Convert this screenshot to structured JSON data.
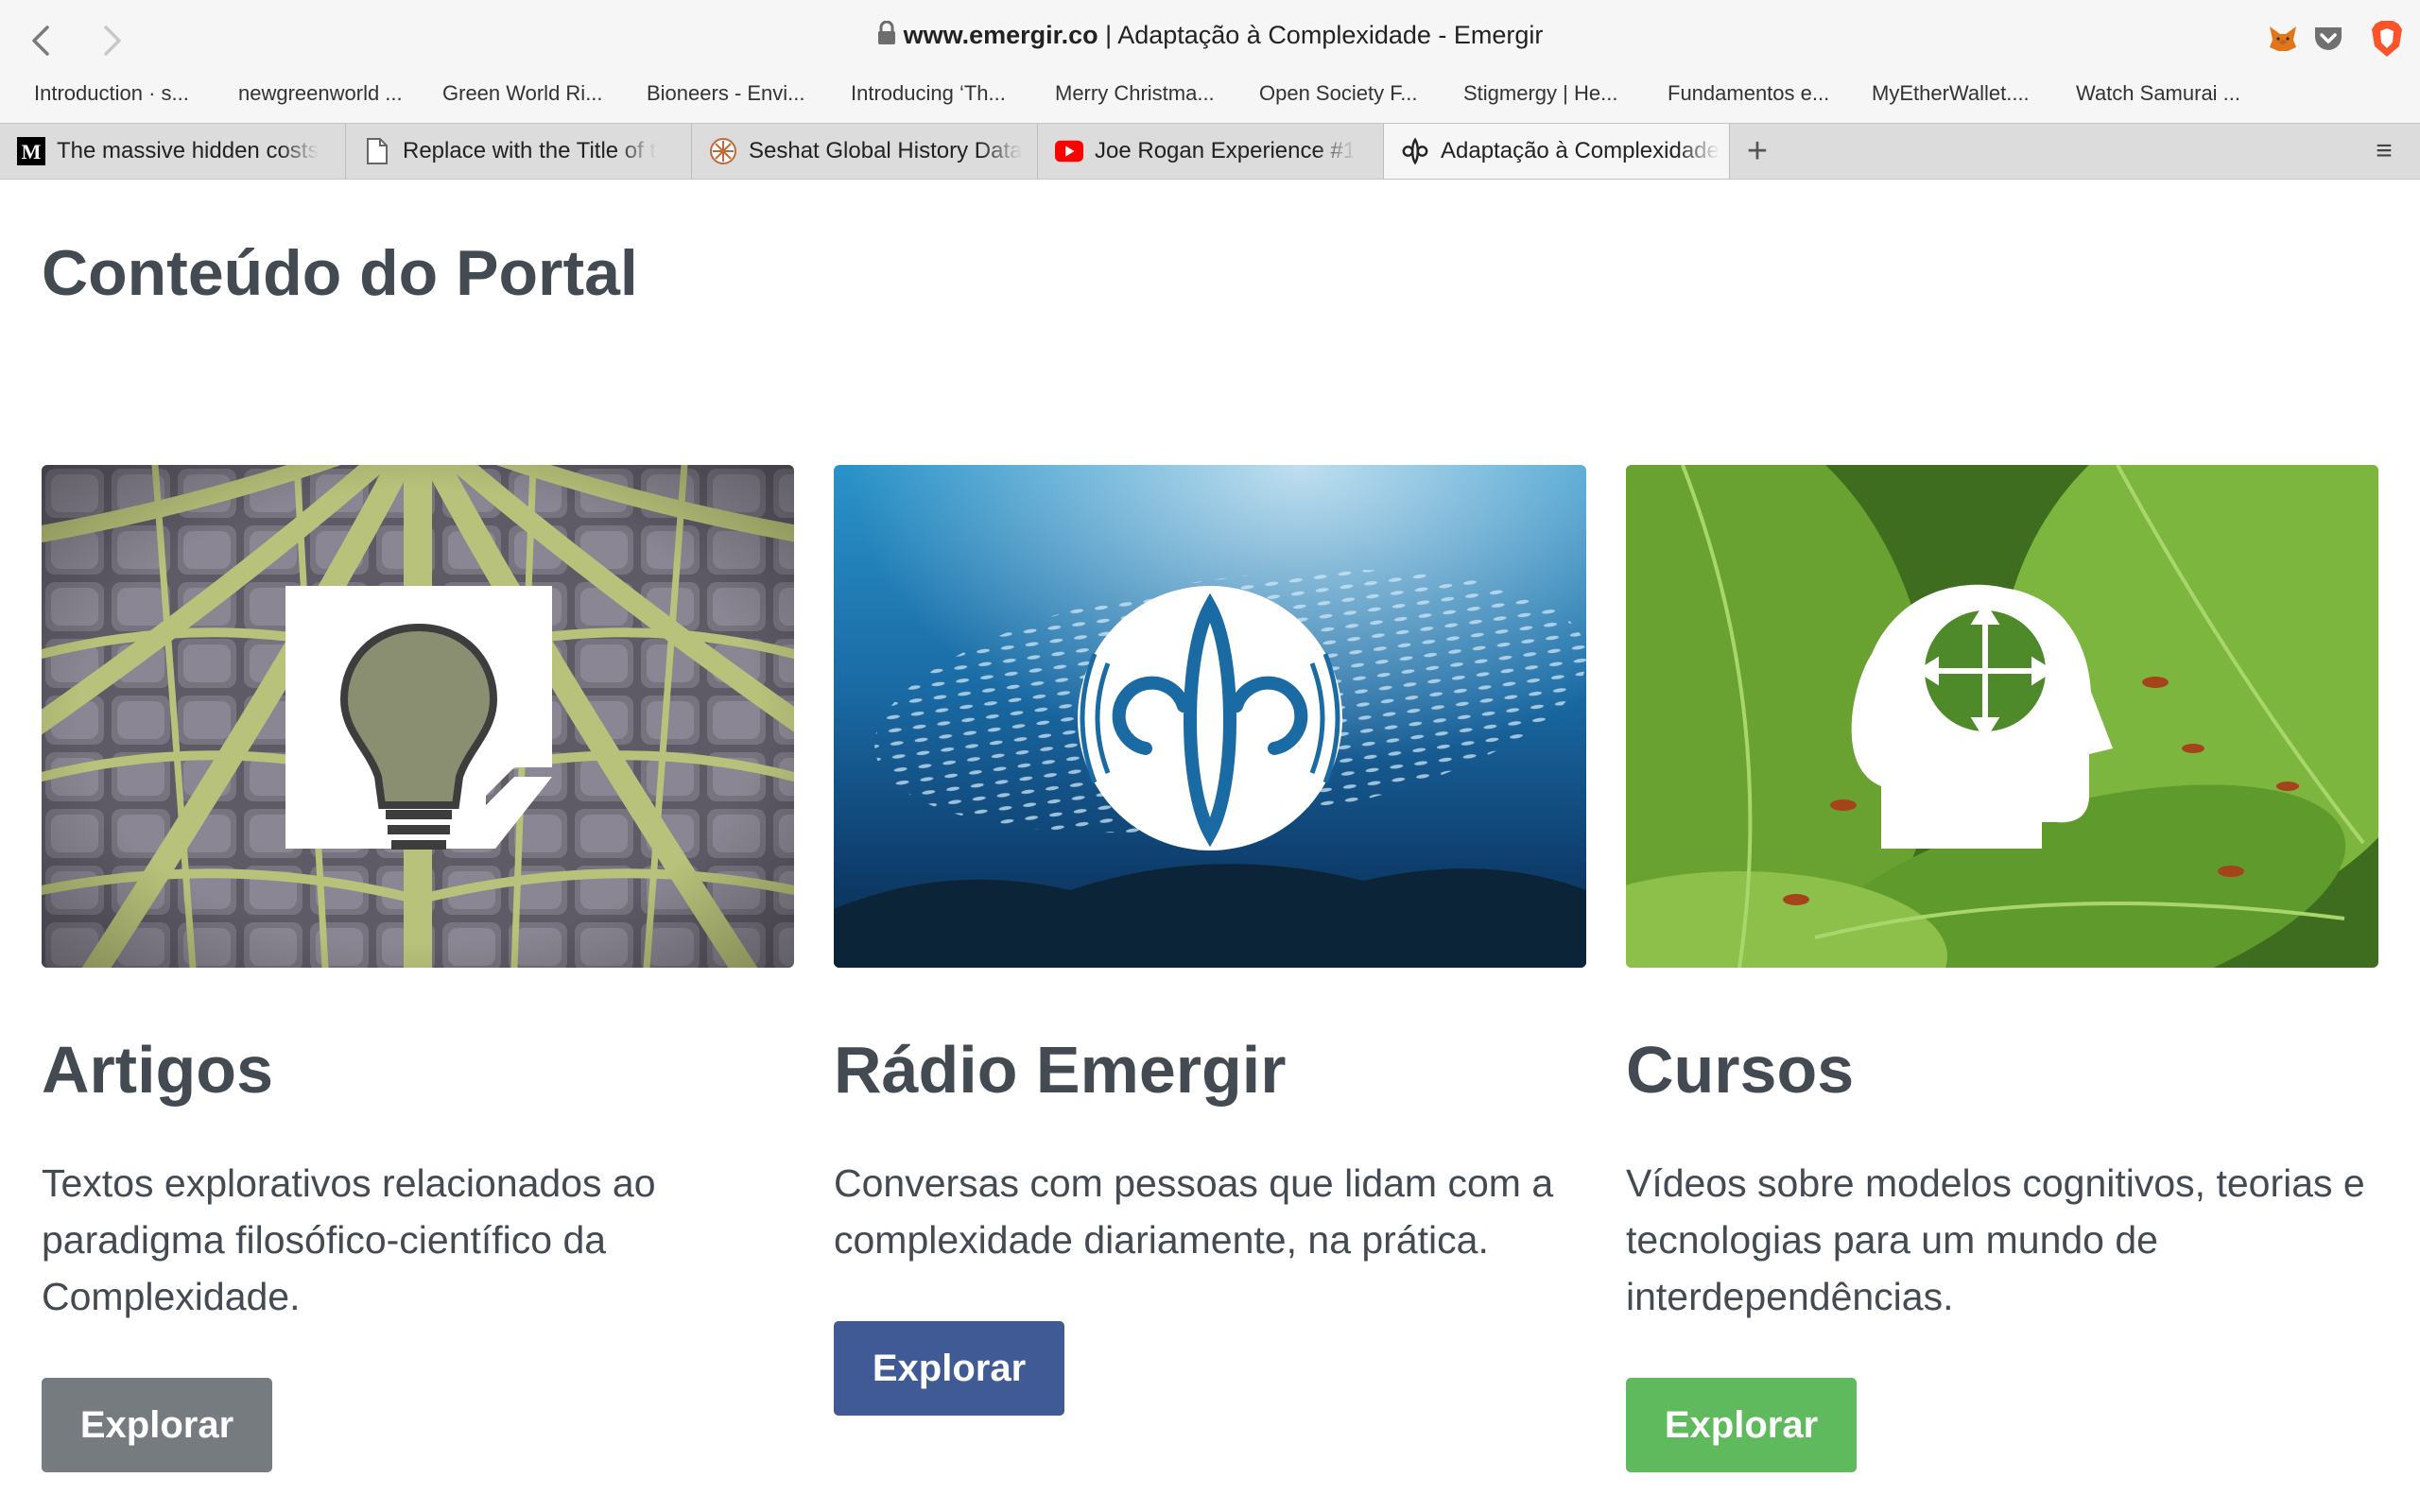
{
  "browser": {
    "address": {
      "domain": "www.emergir.co",
      "separator": " | ",
      "page_title": "Adaptação à Complexidade - Emergir"
    },
    "bookmarks": [
      {
        "label": "Introduction · s..."
      },
      {
        "label": "newgreenworld ..."
      },
      {
        "label": "Green World Ri..."
      },
      {
        "label": "Bioneers - Envi..."
      },
      {
        "label": "Introducing ‘Th..."
      },
      {
        "label": "Merry Christma..."
      },
      {
        "label": "Open Society F..."
      },
      {
        "label": "Stigmergy | He..."
      },
      {
        "label": "Fundamentos e..."
      },
      {
        "label": "MyEtherWallet...."
      },
      {
        "label": "Watch Samurai ..."
      }
    ],
    "tabs": [
      {
        "title": "The massive hidden costs",
        "favicon": "medium-icon"
      },
      {
        "title": "Replace with the Title of t",
        "favicon": "document-icon"
      },
      {
        "title": "Seshat Global History Data",
        "favicon": "seshat-icon"
      },
      {
        "title": "Joe Rogan Experience #1",
        "favicon": "youtube-icon"
      },
      {
        "title": "Adaptação à Complexidade",
        "favicon": "emergir-icon",
        "active": true
      }
    ],
    "new_tab_glyph": "+",
    "tab_menu_glyph": "≡"
  },
  "page": {
    "heading": "Conteúdo do Portal",
    "cards": [
      {
        "title": "Artigos",
        "text": "Textos explorativos relacionados ao paradigma filosófico-científico da Complexidade.",
        "button": "Explorar",
        "button_color": "#767b80",
        "image": "leaf-veins-photo",
        "overlay_icon": "lightbulb-document-icon"
      },
      {
        "title": "Rádio Emergir",
        "text": "Conversas com pessoas que lidam com a complexidade diariamente, na prática.",
        "button": "Explorar",
        "button_color": "#3f5a95",
        "image": "fish-school-photo",
        "overlay_icon": "emergir-radio-icon"
      },
      {
        "title": "Cursos",
        "text": "Vídeos sobre modelos cognitivos, teorias e tecnologias para um mundo de interdependências.",
        "button": "Explorar",
        "button_color": "#5fba5e",
        "image": "ants-on-leaves-photo",
        "overlay_icon": "head-arrows-icon"
      }
    ]
  }
}
